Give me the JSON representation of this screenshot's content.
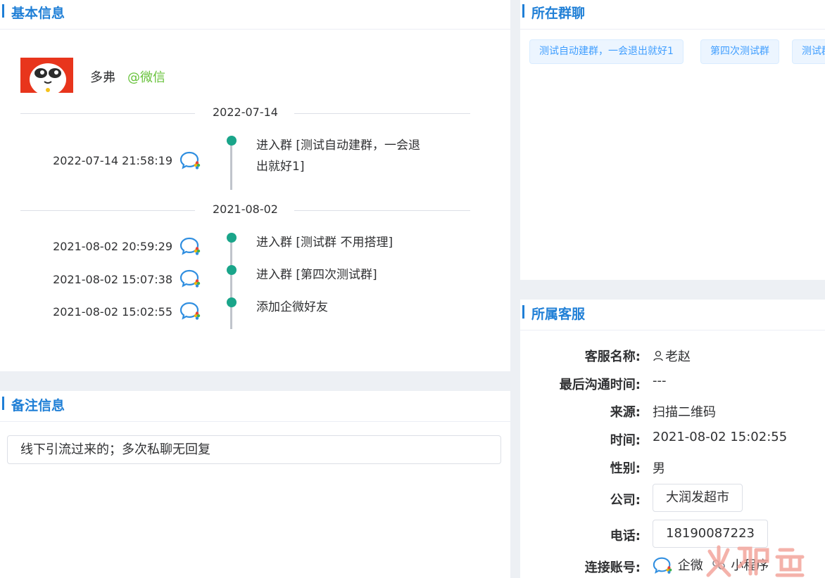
{
  "basic": {
    "title": "基本信息",
    "nickname": "多弗",
    "source": "@微信",
    "timeline": [
      {
        "date": "2022-07-14",
        "events": [
          {
            "time": "2022-07-14 21:58:19",
            "text": "进入群 [测试自动建群，一会退出就好1]"
          }
        ]
      },
      {
        "date": "2021-08-02",
        "events": [
          {
            "time": "2021-08-02 20:59:29",
            "text": "进入群 [测试群 不用搭理]"
          },
          {
            "time": "2021-08-02 15:07:38",
            "text": "进入群 [第四次测试群]"
          },
          {
            "time": "2021-08-02 15:02:55",
            "text": "添加企微好友"
          }
        ]
      }
    ]
  },
  "note": {
    "title": "备注信息",
    "content": "线下引流过来的；多次私聊无回复"
  },
  "groups": {
    "title": "所在群聊",
    "tags": [
      "测试自动建群，一会退出就好1",
      "第四次测试群",
      "测试群"
    ]
  },
  "service": {
    "title": "所属客服",
    "rows": [
      {
        "label": "客服名称:",
        "value": "老赵"
      },
      {
        "label": "最后沟通时间:",
        "value": "---"
      },
      {
        "label": "来源:",
        "value": "扫描二维码"
      },
      {
        "label": "时间:",
        "value": "2021-08-02 15:02:55"
      },
      {
        "label": "性别:",
        "value": "男"
      },
      {
        "label": "公司:",
        "value": "大润发超市"
      },
      {
        "label": "电话:",
        "value": "18190087223"
      },
      {
        "label": "连接账号:",
        "value": "企微",
        "value2": "小程序"
      }
    ]
  },
  "colors": {
    "accent": "#1f7fd6",
    "timeline_dot": "#1aa58a",
    "source_green": "#67c23a",
    "tag_blue": "#409eff"
  },
  "icons": {
    "avatar": "cartoon-avatar",
    "channel": "wecom-chat-icon",
    "service_person": "person-icon"
  }
}
